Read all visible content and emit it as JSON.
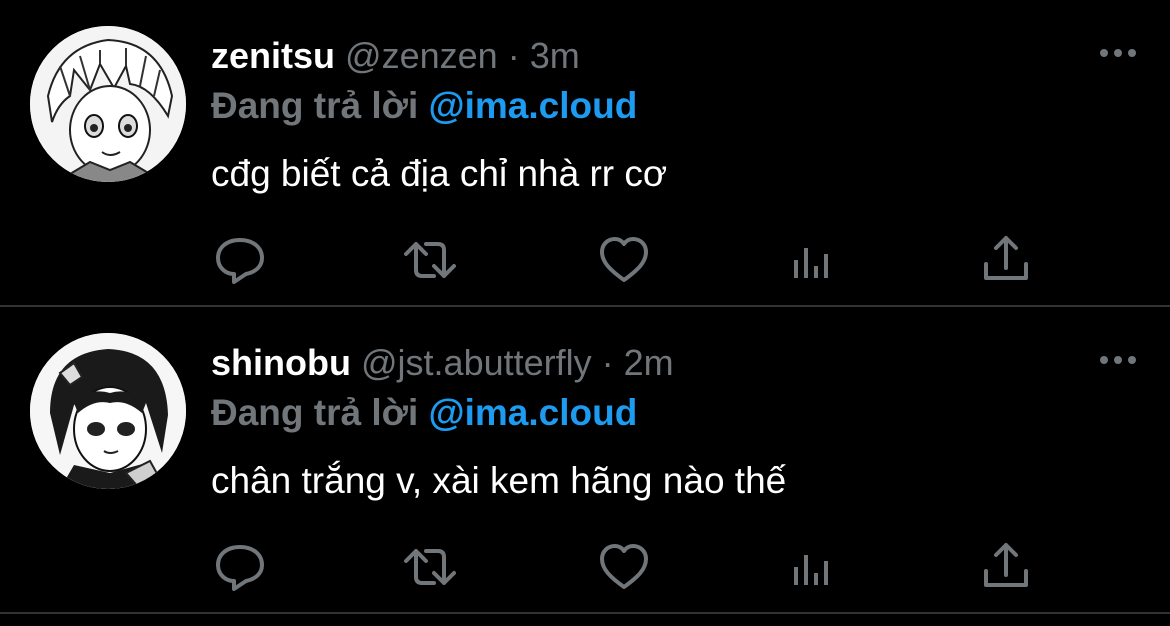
{
  "colors": {
    "background": "#000000",
    "name": "#ffffff",
    "muted": "#71767b",
    "mention": "#1d9bf0",
    "divider": "#2f3336",
    "icon": "#71767b"
  },
  "tweets": [
    {
      "name": "zenitsu",
      "handle": "@zenzen",
      "separator": "·",
      "time": "3m",
      "replying_label": "Đang trả lời",
      "replying_to": "@ima.cloud",
      "text": "cđg biết cả địa chỉ nhà rr cơ",
      "avatar_icon": "anime-avatar-zenitsu"
    },
    {
      "name": "shinobu",
      "handle": "@jst.abutterfly",
      "separator": "·",
      "time": "2m",
      "replying_label": "Đang trả lời",
      "replying_to": "@ima.cloud",
      "text": "chân trắng v, xài kem hãng nào thế",
      "avatar_icon": "anime-avatar-shinobu"
    }
  ],
  "action_icons": [
    "reply-icon",
    "retweet-icon",
    "like-icon",
    "views-icon",
    "share-icon"
  ],
  "more_icon": "more-options-icon"
}
